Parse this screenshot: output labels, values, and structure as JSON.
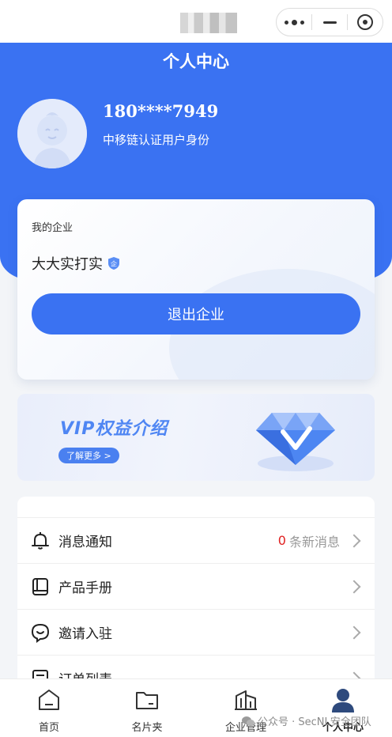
{
  "header": {
    "title": "个人中心",
    "phone": "180****7949",
    "id_status": "中移链认证用户身份"
  },
  "company": {
    "label": "我的企业",
    "name": "大大实打实",
    "exit_label": "退出企业"
  },
  "vip": {
    "title": "VIP权益介绍",
    "more_label": "了解更多 >"
  },
  "menu": {
    "items": [
      {
        "label": "消息通知",
        "count": "0",
        "suffix": "条新消息",
        "icon": "bell-icon"
      },
      {
        "label": "产品手册",
        "icon": "book-icon"
      },
      {
        "label": "邀请入驻",
        "icon": "chat-bubble-icon"
      },
      {
        "label": "订单列表",
        "icon": "order-list-icon"
      }
    ]
  },
  "tabs": [
    {
      "label": "首页",
      "icon": "home-icon"
    },
    {
      "label": "名片夹",
      "icon": "folder-icon"
    },
    {
      "label": "企业管理",
      "icon": "building-icon"
    },
    {
      "label": "个人中心",
      "icon": "user-icon",
      "active": true
    }
  ],
  "watermark": "公众号 · SecNL安全团队",
  "colors": {
    "primary": "#3a72f2",
    "alert": "#e02020",
    "background": "#f3f5f8"
  }
}
